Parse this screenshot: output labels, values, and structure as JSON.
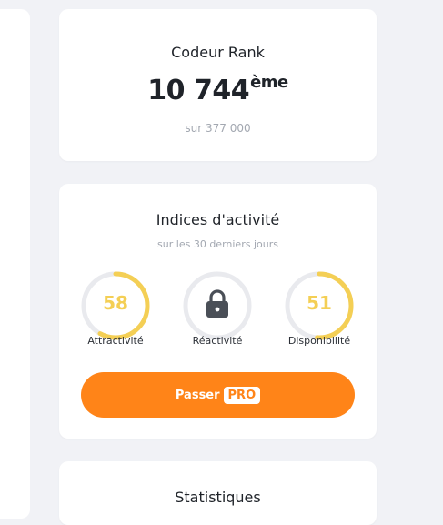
{
  "rank_card": {
    "title": "Codeur Rank",
    "value": "10 744",
    "suffix": "ème",
    "subtitle": "sur 377 000"
  },
  "activity_card": {
    "title": "Indices d'activité",
    "subtitle": "sur les 30 derniers jours",
    "gauges": [
      {
        "label": "Attractivité",
        "value": "58",
        "fraction": 0.58,
        "locked": false,
        "icon": ""
      },
      {
        "label": "Réactivité",
        "value": "",
        "fraction": 0,
        "locked": true,
        "icon": "lock-icon"
      },
      {
        "label": "Disponibilité",
        "value": "51",
        "fraction": 0.51,
        "locked": false,
        "icon": ""
      }
    ],
    "button": {
      "label": "Passer",
      "badge": "PRO"
    }
  },
  "stats_card": {
    "title": "Statistiques"
  },
  "colors": {
    "accent": "#ff8418",
    "gauge_fill": "#f4cf55",
    "gauge_track": "#e9eaee",
    "lock": "#4a4f57",
    "background": "#f1f2f6"
  }
}
